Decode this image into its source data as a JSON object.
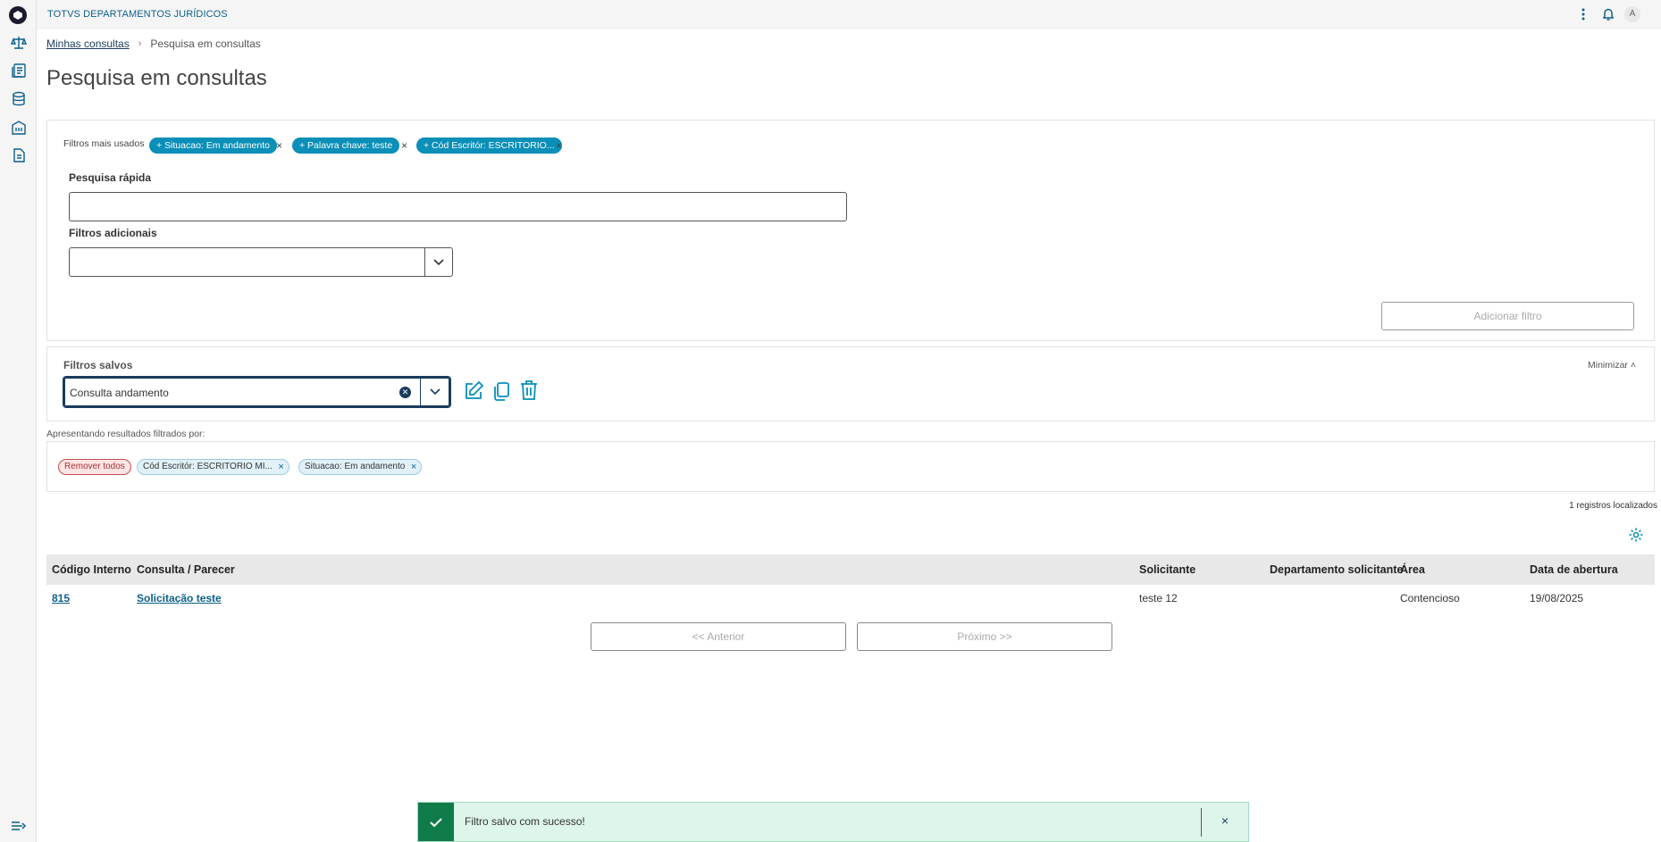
{
  "app": {
    "title": "TOTVS DEPARTAMENTOS JURÍDICOS",
    "user_initial": "A"
  },
  "sidebar": {
    "items": [
      {
        "icon": "scale-icon"
      },
      {
        "icon": "document-list-icon"
      },
      {
        "icon": "database-icon"
      },
      {
        "icon": "building-icon"
      },
      {
        "icon": "file-icon"
      }
    ],
    "collapse_icon": "expand-menu-icon"
  },
  "breadcrumb": {
    "parent": "Minhas consultas",
    "current": "Pesquisa em consultas"
  },
  "page": {
    "title": "Pesquisa em consultas"
  },
  "filters": {
    "most_used_label": "Filtros mais usados",
    "chips": [
      "+ Situacao: Em andamento",
      "+ Palavra chave: teste",
      "+ Cód Escritór: ESCRITORIO..."
    ],
    "quick_search_label": "Pesquisa rápida",
    "quick_search_value": "",
    "additional_label": "Filtros adicionais",
    "additional_value": "",
    "add_filter_button": "Adicionar filtro"
  },
  "saved_filters": {
    "label": "Filtros salvos",
    "minimize": "Minimizar",
    "selected": "Consulta andamento"
  },
  "results": {
    "label": "Apresentando resultados filtrados por:",
    "remove_all": "Remover todos",
    "active_filters": [
      "Cód Escritór: ESCRITORIO MI...",
      "Situacao: Em andamento"
    ],
    "count": "1 registros localizados"
  },
  "table": {
    "columns": [
      "Código Interno",
      "Consulta / Parecer",
      "Solicitante",
      "Departamento solicitante",
      "Área",
      "Data de abertura"
    ],
    "rows": [
      [
        "815",
        "Solicitação teste",
        "teste 12",
        "",
        "Contencioso",
        "19/08/2025"
      ]
    ]
  },
  "pager": {
    "prev": "<< Anterior",
    "next": "Próximo >>"
  },
  "toast": {
    "message": "Filtro salvo com sucesso!",
    "close": "×"
  },
  "colors": {
    "accent": "#0a8fb8",
    "primary": "#1a3b5c",
    "success": "#0f7b49"
  }
}
